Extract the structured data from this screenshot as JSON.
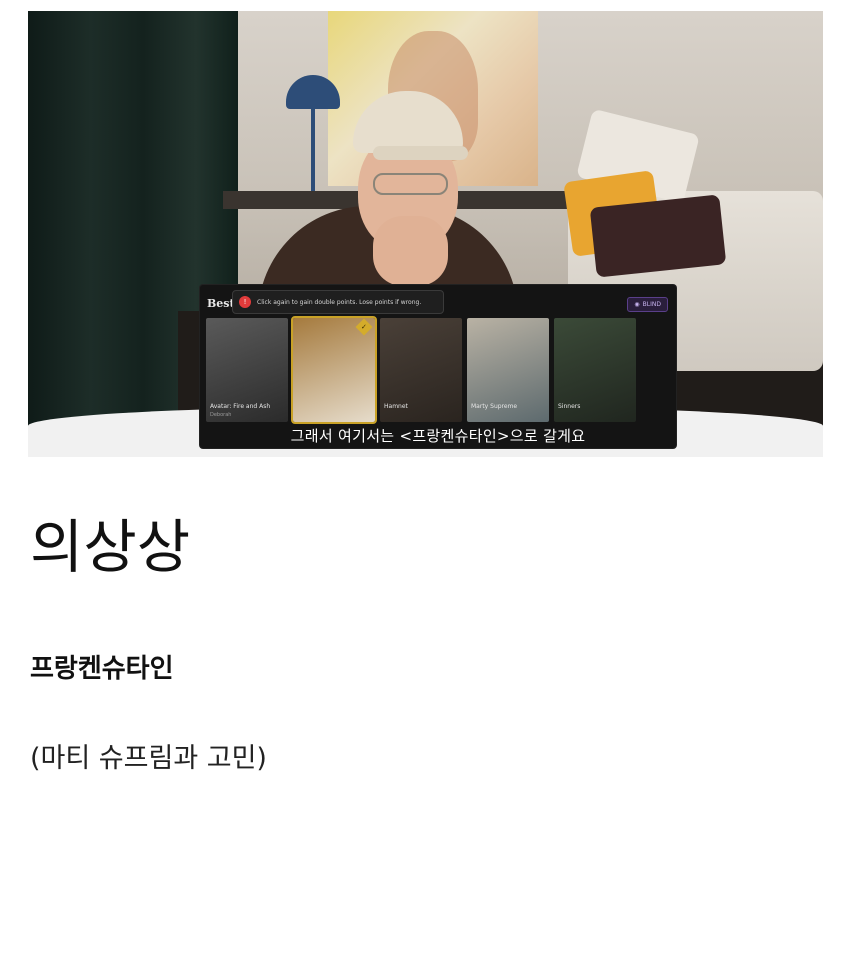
{
  "overlay": {
    "title": "Best",
    "toast_text": "Click again to gain double points. Lose points if wrong.",
    "blind_label": "BLIND",
    "cards": [
      {
        "label": "Avatar: Fire and Ash",
        "sub": "Deborah",
        "selected": false,
        "colors": [
          "#5a5a5a",
          "#2b2b2b"
        ]
      },
      {
        "label": "",
        "sub": "",
        "selected": true,
        "colors": [
          "#a57a3d",
          "#e6dccb"
        ]
      },
      {
        "label": "Hamnet",
        "sub": "",
        "selected": false,
        "colors": [
          "#4a4038",
          "#2a241f"
        ]
      },
      {
        "label": "Marty Supreme",
        "sub": "",
        "selected": false,
        "colors": [
          "#b9b2a4",
          "#5d6a6e"
        ]
      },
      {
        "label": "Sinners",
        "sub": "",
        "selected": false,
        "colors": [
          "#3b4a38",
          "#20261f"
        ]
      }
    ],
    "subtitle": "그래서 여기서는 <프랑켄슈타인>으로 갈게요"
  },
  "article": {
    "heading": "의상상",
    "winner": "프랑켄슈타인",
    "note": "(마티 슈프림과 고민)"
  }
}
